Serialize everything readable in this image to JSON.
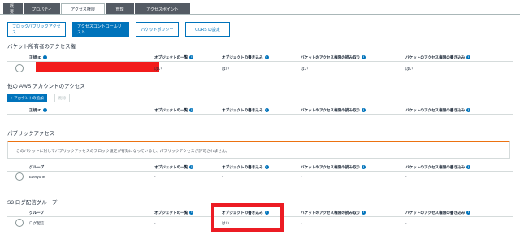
{
  "tabs": [
    {
      "label": "概要"
    },
    {
      "label": "プロパティ"
    },
    {
      "label": "アクセス権限"
    },
    {
      "label": "管理"
    },
    {
      "label": "アクセスポイント"
    }
  ],
  "sub_buttons": [
    {
      "label": "ブロックパブリックアクセス"
    },
    {
      "label": "アクセスコントロールリスト"
    },
    {
      "label": "バケットポリシー"
    },
    {
      "label": "CORS の設定"
    }
  ],
  "owner_section": {
    "title": "バケット所有者のアクセス権",
    "columns": [
      "正規 ID",
      "オブジェクトの一覧",
      "オブジェクトの書き込み",
      "バケットのアクセス権限の読み取り",
      "バケットのアクセス権限の書き込み"
    ],
    "row": [
      "はい",
      "はい",
      "はい",
      "はい"
    ]
  },
  "other_accounts": {
    "title": "他の AWS アカウントのアクセス",
    "add_button": "+ アカウントの追加",
    "delete_button": "削除",
    "columns": [
      "正規 ID",
      "オブジェクトの一覧",
      "オブジェクトの書き込み",
      "バケットのアクセス権限の読み取り",
      "バケットのアクセス権限の書き込み"
    ]
  },
  "public_section": {
    "title": "パブリックアクセス",
    "alert": "このバケットに対してパブリックアクセスのブロック設定が有効になっていると、パブリックアクセスが許可されません。",
    "columns": [
      "グループ",
      "オブジェクトの一覧",
      "オブジェクトの書き込み",
      "バケットのアクセス権限の読み取り",
      "バケットのアクセス権限の書き込み"
    ],
    "row": [
      "Everyone",
      "-",
      "-",
      "-",
      "-"
    ]
  },
  "log_section": {
    "title": "S3 ログ配信グループ",
    "columns": [
      "グループ",
      "オブジェクトの一覧",
      "オブジェクトの書き込み",
      "バケットのアクセス権限の読み取り",
      "バケットのアクセス権限の書き込み"
    ],
    "row": [
      "ログ配信",
      "-",
      "はい",
      "-",
      "-"
    ]
  },
  "info_icon_glyph": "i",
  "colors": {
    "accent": "#0073bb",
    "alert_border": "#ec7211",
    "highlight": "#ec1c24"
  }
}
